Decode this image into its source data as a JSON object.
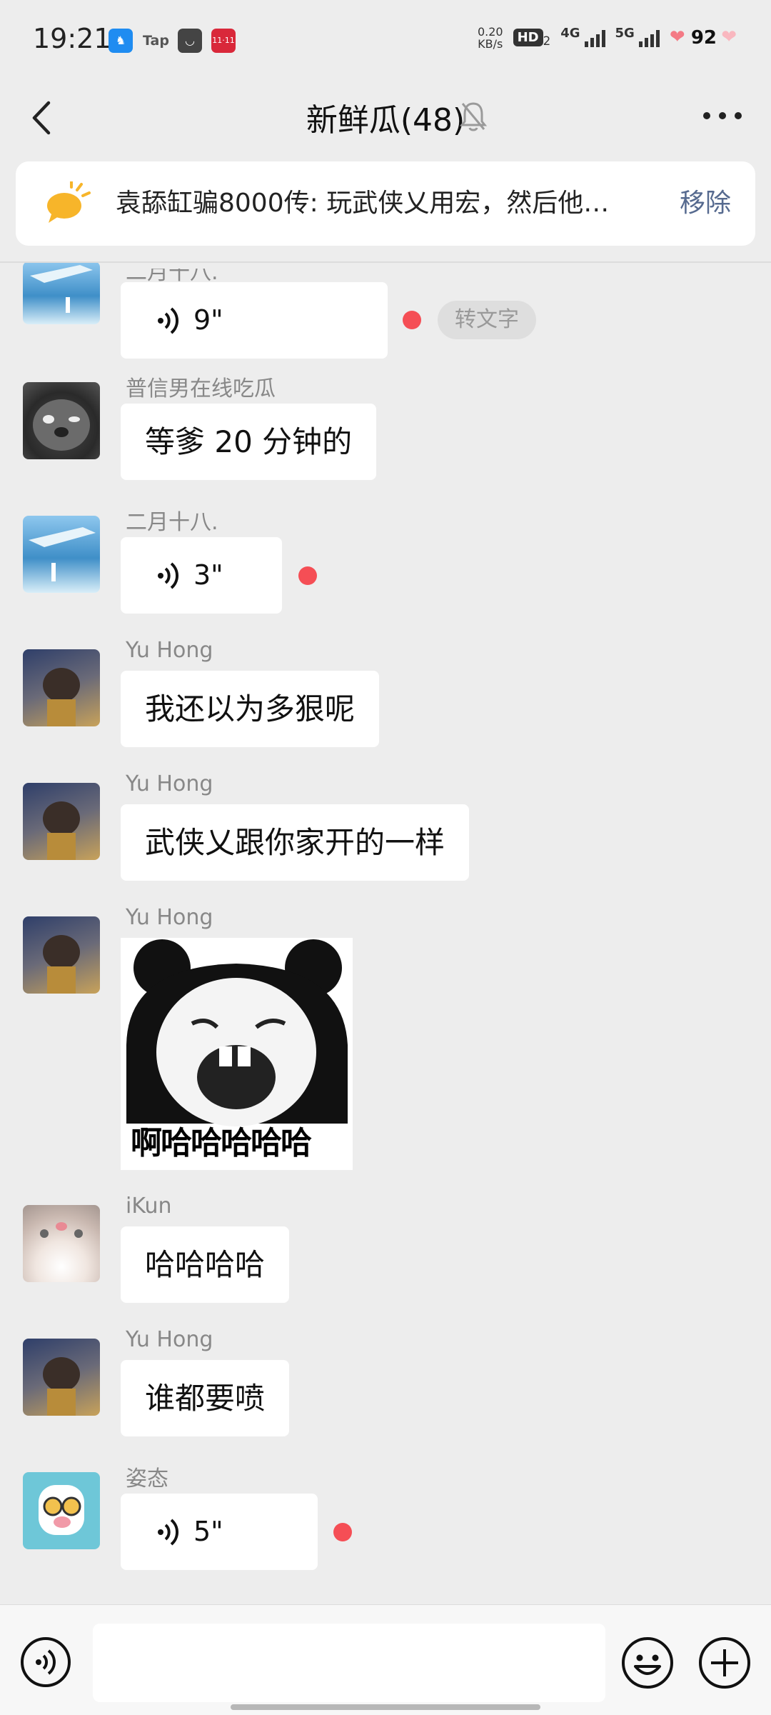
{
  "status_bar": {
    "time": "19:21",
    "apps": [
      {
        "name": "app-icon-blue",
        "label": "",
        "color": "#1f8cf1"
      },
      {
        "name": "app-icon-tap",
        "label": "Tap",
        "color": "#6a6a6a"
      },
      {
        "name": "app-icon-dark",
        "label": "",
        "color": "#444444"
      },
      {
        "name": "app-icon-red",
        "label": "11·11",
        "color": "#d9283a"
      }
    ],
    "net_speed": "0.20",
    "net_speed_unit": "KB/s",
    "hd": "HD",
    "hd_sub": "2",
    "net1": "4G",
    "net2": "5G",
    "battery": "92"
  },
  "header": {
    "title": "新鲜瓜(48)"
  },
  "pinned": {
    "text": "袁舔缸骗8000传: 玩武侠乂用宏，然后他…",
    "remove_label": "移除"
  },
  "messages": [
    {
      "sender": "二月十八.",
      "type": "voice",
      "duration": "9\"",
      "unread": true,
      "to_text_label": "转文字"
    },
    {
      "sender": "普信男在线吃瓜",
      "type": "text",
      "text": "等爹 20 分钟的"
    },
    {
      "sender": "二月十八.",
      "type": "voice",
      "duration": "3\"",
      "unread": true
    },
    {
      "sender": "Yu   Hong",
      "type": "text",
      "text": "我还以为多狠呢"
    },
    {
      "sender": "Yu   Hong",
      "type": "text",
      "text": "武侠乂跟你家开的一样"
    },
    {
      "sender": "Yu   Hong",
      "type": "sticker",
      "caption": "啊哈哈哈哈哈"
    },
    {
      "sender": "iKun",
      "type": "text",
      "text": "哈哈哈哈"
    },
    {
      "sender": "Yu   Hong",
      "type": "text",
      "text": "谁都要喷"
    },
    {
      "sender": "姿态",
      "type": "voice",
      "duration": "5\"",
      "unread": true
    }
  ],
  "input": {
    "value": "",
    "placeholder": ""
  },
  "colors": {
    "background": "#ededed",
    "bubble": "#ffffff",
    "unread_dot": "#f54e55",
    "link": "#566a8f"
  }
}
